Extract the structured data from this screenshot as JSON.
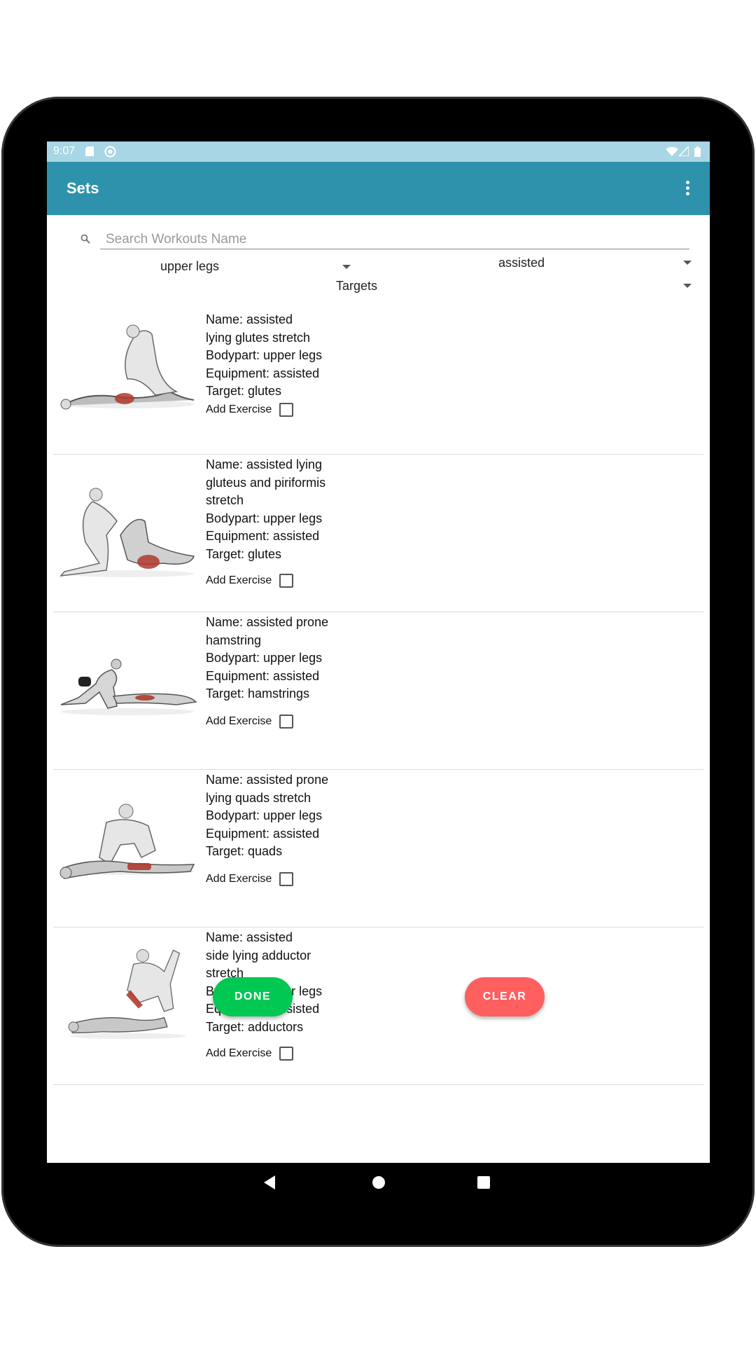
{
  "status_bar": {
    "time": "9:07"
  },
  "app_bar": {
    "title": "Sets"
  },
  "search": {
    "placeholder": "Search Workouts Name",
    "value": ""
  },
  "filters": {
    "bodypart": "upper legs",
    "equipment": "assisted",
    "target": "Targets"
  },
  "add_exercise_label": "Add Exercise",
  "exercises": [
    {
      "name": "Name: assisted\nlying glutes stretch",
      "bodypart": "Bodypart: upper legs",
      "equipment": "Equipment: assisted",
      "target": "Target: glutes",
      "checked": false
    },
    {
      "name": "Name: assisted lying\ngluteus and piriformis\nstretch",
      "bodypart": "Bodypart: upper legs",
      "equipment": "Equipment: assisted",
      "target": "Target: glutes",
      "checked": false
    },
    {
      "name": "Name: assisted prone\nhamstring",
      "bodypart": "Bodypart: upper legs",
      "equipment": "Equipment: assisted",
      "target": "Target: hamstrings",
      "checked": false
    },
    {
      "name": "Name: assisted prone\nlying quads stretch",
      "bodypart": "Bodypart: upper legs",
      "equipment": "Equipment: assisted",
      "target": "Target: quads",
      "checked": false
    },
    {
      "name": "Name: assisted\nside lying adductor\nstretch",
      "bodypart": "Bodypart: upper legs",
      "equipment": "Equipment: assisted",
      "target": "Target: adductors",
      "checked": false
    }
  ],
  "buttons": {
    "done": "DONE",
    "clear": "CLEAR"
  },
  "colors": {
    "app_bar": "#2e92ac",
    "status_bar": "#a8d6e4",
    "done": "#00c853",
    "clear": "#ff5f5f",
    "muscle": "#b03a2e"
  }
}
